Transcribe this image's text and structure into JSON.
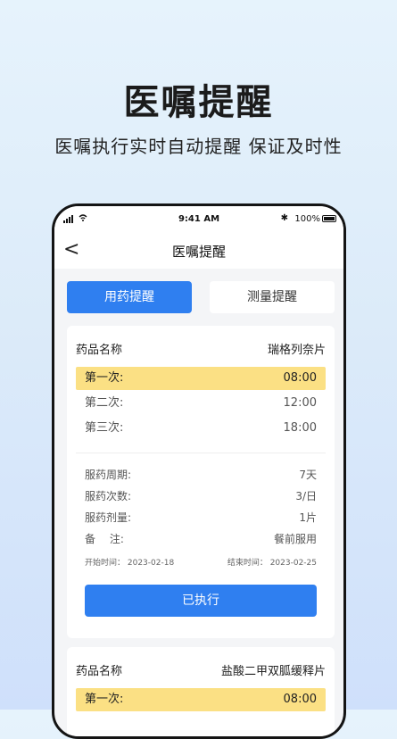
{
  "hero": {
    "title": "医嘱提醒",
    "subtitle": "医嘱执行实时自动提醒 保证及时性"
  },
  "status_bar": {
    "time": "9:41 AM",
    "battery": "100%",
    "icons": [
      "signal-icon",
      "wifi-icon",
      "bluetooth-icon",
      "battery-icon"
    ]
  },
  "nav": {
    "back": "<",
    "title": "医嘱提醒"
  },
  "tabs": [
    {
      "label": "用药提醒",
      "active": true
    },
    {
      "label": "测量提醒",
      "active": false
    }
  ],
  "cards": [
    {
      "drug_label": "药品名称",
      "drug_name": "瑞格列奈片",
      "doses": [
        {
          "label": "第一次:",
          "time": "08:00",
          "highlight": true
        },
        {
          "label": "第二次:",
          "time": "12:00",
          "highlight": false
        },
        {
          "label": "第三次:",
          "time": "18:00",
          "highlight": false
        }
      ],
      "info": [
        {
          "label": "服药周期:",
          "value": "7天"
        },
        {
          "label": "服药次数:",
          "value": "3/日"
        },
        {
          "label": "服药剂量:",
          "value": "1片"
        },
        {
          "label": "备　 注:",
          "value": "餐前服用"
        }
      ],
      "start": "开始时间： 2023-02-18",
      "end": "结束时间： 2023-02-25",
      "button": "已执行"
    },
    {
      "drug_label": "药品名称",
      "drug_name": "盐酸二甲双胍缓释片",
      "doses": [
        {
          "label": "第一次:",
          "time": "08:00",
          "highlight": true
        }
      ]
    }
  ],
  "colors": {
    "accent": "#2f7ff0",
    "highlight": "#fbe084"
  }
}
